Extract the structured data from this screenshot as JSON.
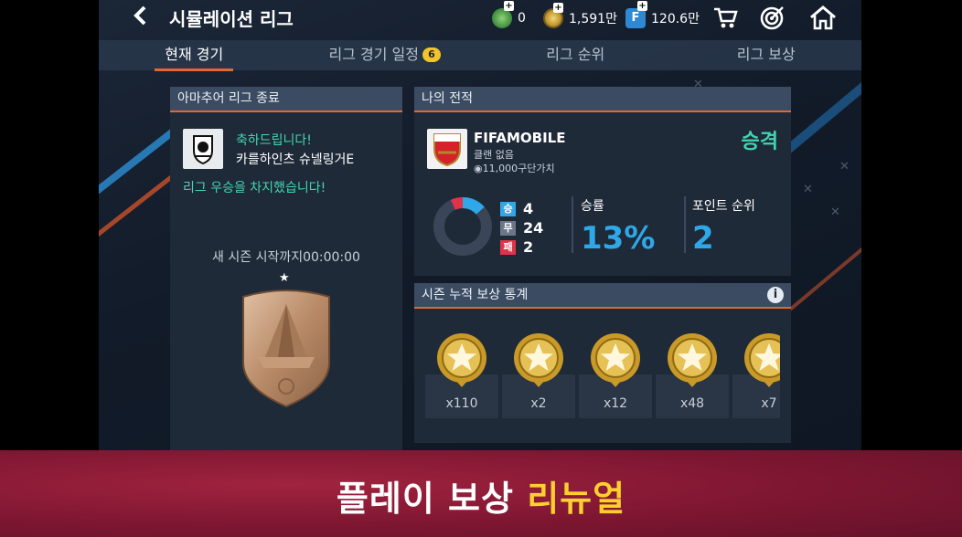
{
  "header": {
    "back_icon": "chevron-left-icon",
    "title": "시뮬레이션 리그",
    "currencies": [
      {
        "icon": "xp-icon",
        "value": "0"
      },
      {
        "icon": "coin-icon",
        "value": "1,591만"
      },
      {
        "icon": "fifa-points-icon",
        "value": "120.6만"
      }
    ],
    "nav_icons": [
      "cart-icon",
      "target-icon",
      "home-icon"
    ]
  },
  "tabs": [
    {
      "label": "현재 경기",
      "active": true
    },
    {
      "label": "리그 경기 일정",
      "badge": "6"
    },
    {
      "label": "리그 순위"
    },
    {
      "label": "리그 보상"
    }
  ],
  "league_end": {
    "heading": "아마추어 리그 종료",
    "congrats": "축하드립니다!",
    "club_name": "카를하인츠 슈넬링거E",
    "won": "리그 우승을 차지했습니다!",
    "season_timer": "새 시즌 시작까지00:00:00",
    "shield_icon": "bronze-league-shield-icon"
  },
  "record": {
    "heading": "나의 전적",
    "club_badge": "arsenal-crest-icon",
    "team_name": "FIFAMOBILE",
    "club": "클랜 없음",
    "team_value": "11,000구단가치",
    "result": "승격",
    "wins_tag": "승",
    "wins": "4",
    "draws_tag": "무",
    "draws": "24",
    "losses_tag": "패",
    "losses": "2",
    "win_rate_label": "승률",
    "win_rate": "13%",
    "rank_label": "포인트 순위",
    "rank": "2",
    "colors": {
      "win": "#2ea8e8",
      "draw": "#6b7789",
      "loss": "#e0334a"
    }
  },
  "season_rewards": {
    "heading": "시즌 누적 보상 통계",
    "info_icon": "info-icon",
    "items": [
      {
        "icon": "gold-star-medal-icon",
        "count": "x110"
      },
      {
        "icon": "gold-star-medal-icon",
        "count": "x2"
      },
      {
        "icon": "gold-star-medal-icon",
        "count": "x12"
      },
      {
        "icon": "gold-star-medal-icon",
        "count": "x48"
      },
      {
        "icon": "gold-star-medal-icon",
        "count": "x7"
      }
    ]
  },
  "banner": {
    "text_main": "플레이 보상 ",
    "text_highlight": "리뉴얼"
  }
}
